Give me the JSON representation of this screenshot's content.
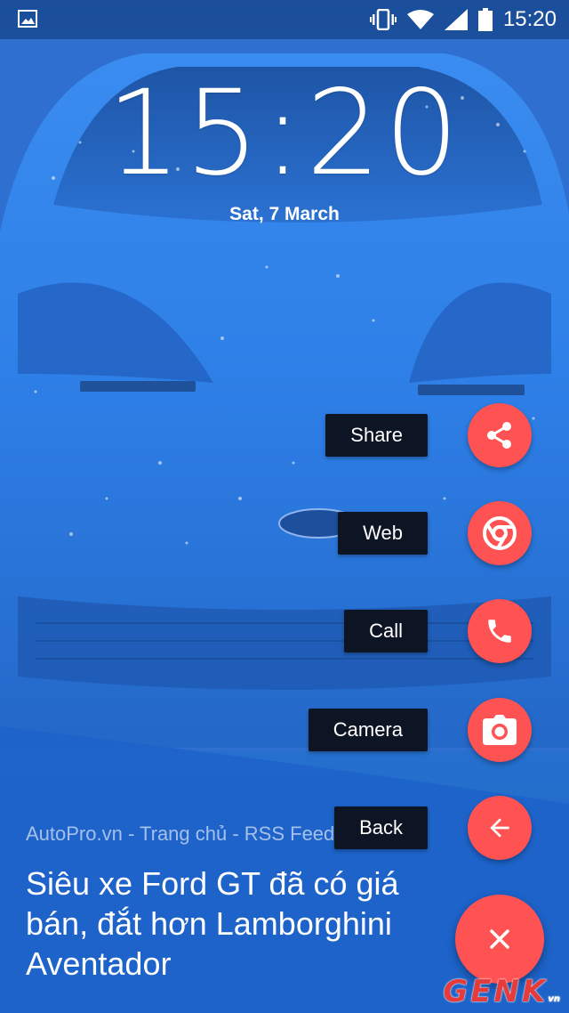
{
  "status_bar": {
    "time": "15:20",
    "icons": [
      "image-notification-icon",
      "vibrate-icon",
      "wifi-icon",
      "signal-icon",
      "battery-icon"
    ]
  },
  "lockscreen": {
    "clock": "15:20",
    "date": "Sat, 7 March"
  },
  "actions": [
    {
      "label": "Share",
      "icon": "share-icon"
    },
    {
      "label": "Web",
      "icon": "chrome-icon"
    },
    {
      "label": "Call",
      "icon": "phone-icon"
    },
    {
      "label": "Camera",
      "icon": "camera-icon"
    },
    {
      "label": "Back",
      "icon": "arrow-back-icon"
    }
  ],
  "main_fab": {
    "icon": "close-icon",
    "label": "×"
  },
  "news": {
    "source": "AutoPro.vn - Trang chủ - RSS Feed",
    "headline": "Siêu xe Ford GT đã có giá bán, đắt hơn Lamborghini Aventador"
  },
  "watermark": {
    "text": "GENK",
    "suffix": "vn"
  },
  "colors": {
    "fab": "#ff5252",
    "label_bg": "#0d1424",
    "background": "#2a7ad8"
  }
}
